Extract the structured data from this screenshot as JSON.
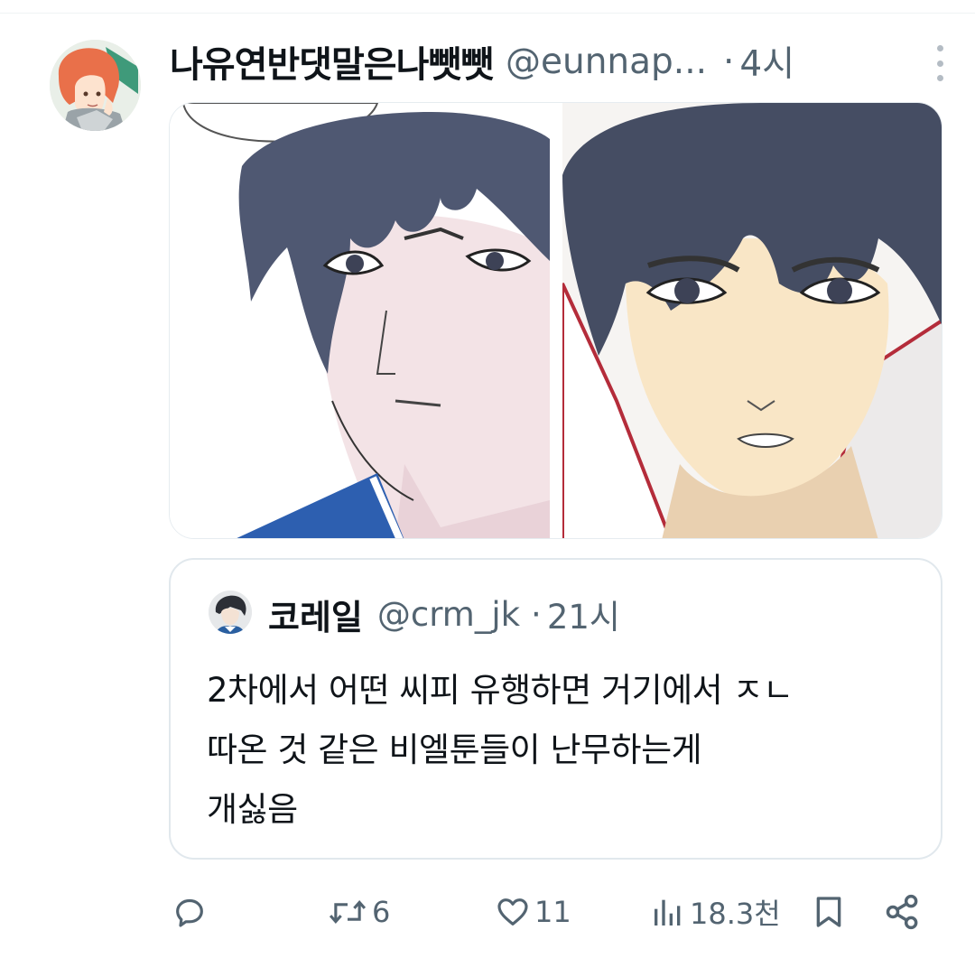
{
  "tweet": {
    "display_name": "나유연반댓말은나뺏뺏",
    "handle": "@eunnap...",
    "separator": "·",
    "time": "4시"
  },
  "media": {
    "images": [
      {
        "icon": "manga-portrait-left"
      },
      {
        "icon": "manga-portrait-right"
      }
    ]
  },
  "quote": {
    "display_name": "코레일",
    "handle": "@crm_jk",
    "separator": "·",
    "time": "21시",
    "text_lines": [
      "2차에서 어떤 씨피 유행하면 거기에서 ㅈㄴ",
      "따온 것 같은 비엘툰들이 난무하는게",
      "개싫음"
    ]
  },
  "actions": {
    "reply_count": "",
    "retweet_count": "6",
    "like_count": "11",
    "views_count": "18.3천"
  },
  "colors": {
    "text_primary": "#0f1419",
    "text_secondary": "#536471",
    "border": "#e1e8ed"
  }
}
